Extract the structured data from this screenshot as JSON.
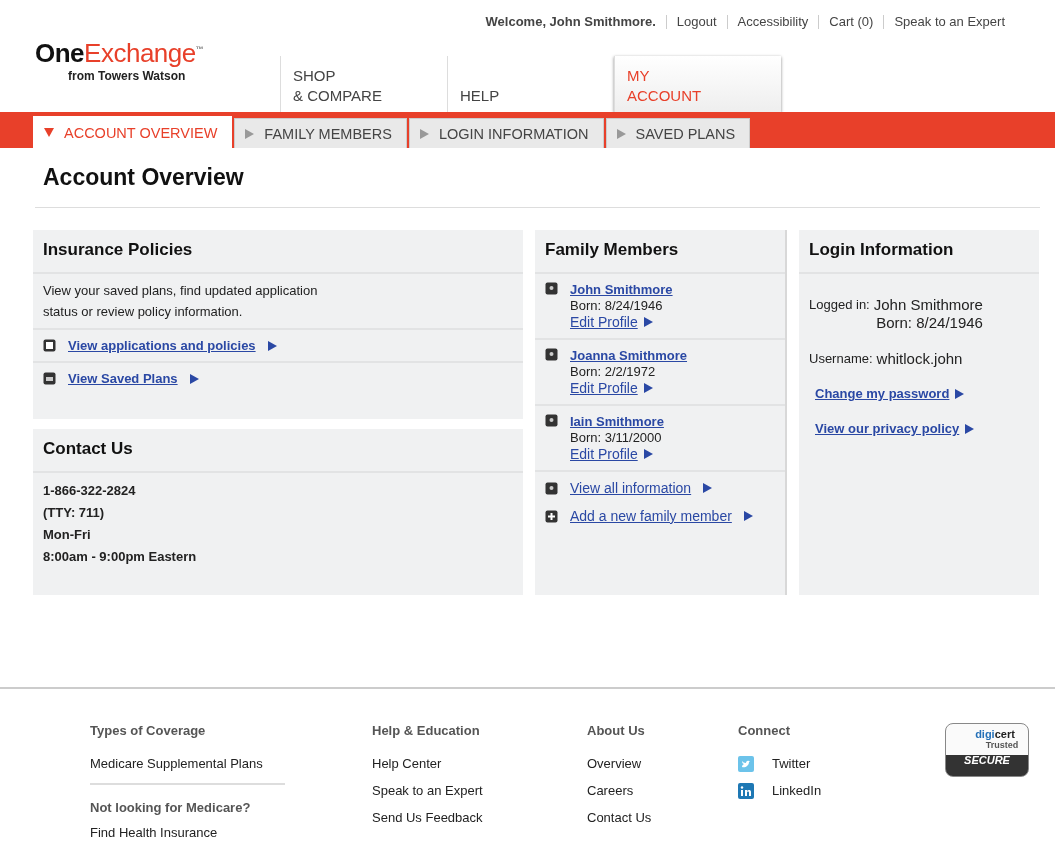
{
  "utility_bar": [
    {
      "kind": "text",
      "label": "Welcome, John Smithmore."
    },
    {
      "kind": "link",
      "label": "Logout"
    },
    {
      "kind": "link",
      "label": "Accessibility"
    },
    {
      "kind": "link",
      "label": "Cart (0)"
    },
    {
      "kind": "link",
      "label": "Speak to an Expert"
    }
  ],
  "logo": {
    "name": "One",
    "name_accent": "Exchange",
    "mark": "™",
    "tagline": "from Towers Watson"
  },
  "main_tabs": [
    {
      "lines": [
        "SHOP",
        "& COMPARE"
      ],
      "selected": false
    },
    {
      "lines": [
        "HELP"
      ],
      "selected": false
    },
    {
      "lines": [
        "MY",
        "ACCOUNT"
      ],
      "selected": true
    }
  ],
  "sub_tabs": [
    {
      "label": "ACCOUNT OVERVIEW",
      "selected": true
    },
    {
      "label": "FAMILY MEMBERS",
      "selected": false
    },
    {
      "label": "LOGIN INFORMATION",
      "selected": false
    },
    {
      "label": "SAVED PLANS",
      "selected": false
    }
  ],
  "page_title": "Account Overview",
  "insurance_policies": {
    "title": "Insurance Policies",
    "description": [
      "View your saved plans, find updated application",
      "status or review policy information."
    ],
    "links": [
      {
        "label": "View applications and policies",
        "kind": "document"
      },
      {
        "label": "View Saved Plans",
        "kind": "folder"
      }
    ]
  },
  "contact_us": {
    "title": "Contact Us",
    "lines": [
      "1-866-322-2824",
      "(TTY: 711)",
      "Mon-Fri",
      "8:00am - 9:00pm Eastern"
    ]
  },
  "family_members": {
    "title": "Family Members",
    "members": [
      {
        "name": "John Smithmore",
        "born": "Born: 8/24/1946",
        "action": "Edit Profile"
      },
      {
        "name": "Joanna Smithmore",
        "born": "Born: 2/2/1972",
        "action": "Edit Profile"
      },
      {
        "name": "Iain Smithmore",
        "born": "Born: 3/11/2000",
        "action": "Edit Profile"
      }
    ],
    "links": [
      {
        "label": "View all information",
        "kind": "person"
      },
      {
        "label": "Add a new family member",
        "kind": "add"
      }
    ]
  },
  "login_information": {
    "title": "Login Information",
    "logged_in_label": "Logged in:",
    "logged_in_name": "John Smithmore",
    "logged_in_born": "Born: 8/24/1946",
    "username_label": "Username:",
    "username": "whitlock.john",
    "links": [
      "Change my password",
      "View our privacy policy"
    ]
  },
  "footer": {
    "columns": [
      {
        "title": "Types of Coverage",
        "items": [
          {
            "label": "Medicare Supplemental Plans",
            "kind": "link"
          },
          {
            "label": "Not looking for Medicare?",
            "kind": "heading"
          },
          {
            "label": "Find Health Insurance",
            "kind": "link"
          }
        ]
      },
      {
        "title": "Help & Education",
        "items": [
          {
            "label": "Help Center",
            "kind": "link"
          },
          {
            "label": "Speak to an Expert",
            "kind": "link"
          },
          {
            "label": "Send Us Feedback",
            "kind": "link"
          }
        ]
      },
      {
        "title": "About Us",
        "items": [
          {
            "label": "Overview",
            "kind": "link"
          },
          {
            "label": "Careers",
            "kind": "link"
          },
          {
            "label": "Contact Us",
            "kind": "link"
          }
        ]
      },
      {
        "title": "Connect",
        "items": [
          {
            "label": "Twitter",
            "kind": "twitter"
          },
          {
            "label": "LinkedIn",
            "kind": "linkedin"
          }
        ]
      }
    ],
    "badge": {
      "brand_a": "digi",
      "brand_b": "cert",
      "trusted": "Trusted",
      "secure": "SECURE"
    }
  }
}
